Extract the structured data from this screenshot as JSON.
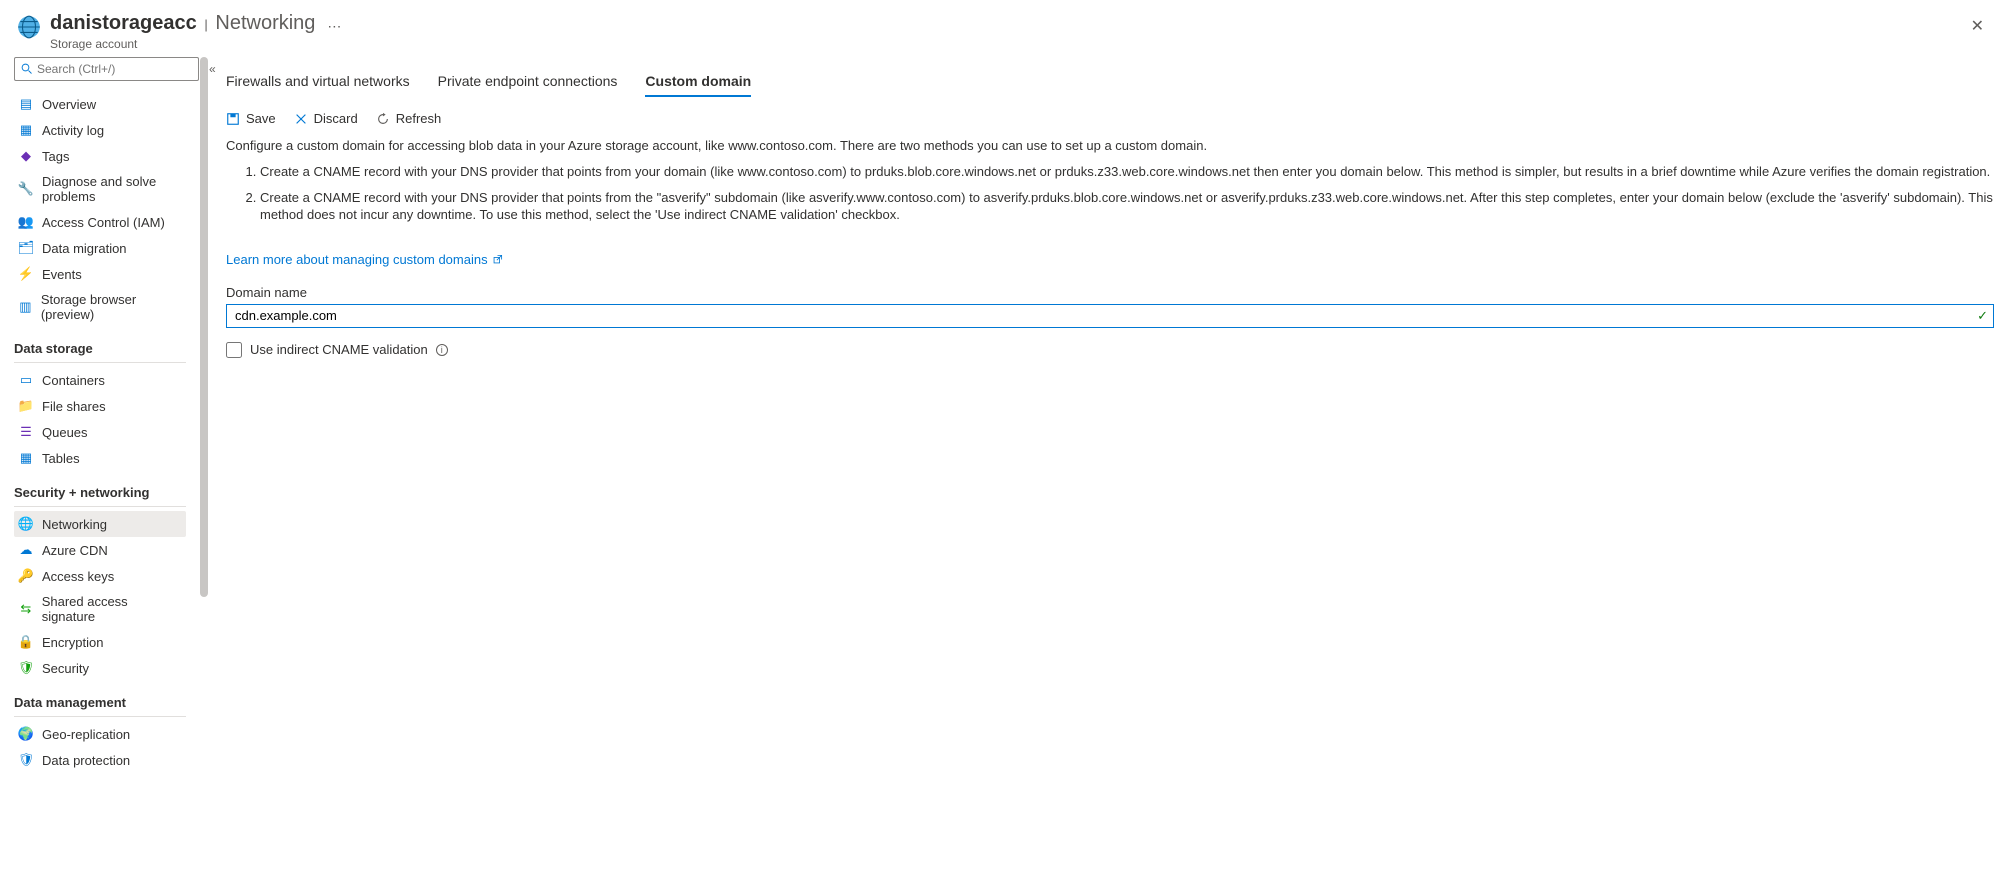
{
  "header": {
    "resource_name": "danistorageacc",
    "section": "Networking",
    "subtitle": "Storage account"
  },
  "search": {
    "placeholder": "Search (Ctrl+/)"
  },
  "nav": {
    "top": [
      {
        "label": "Overview"
      },
      {
        "label": "Activity log"
      },
      {
        "label": "Tags"
      },
      {
        "label": "Diagnose and solve problems"
      },
      {
        "label": "Access Control (IAM)"
      },
      {
        "label": "Data migration"
      },
      {
        "label": "Events"
      },
      {
        "label": "Storage browser (preview)"
      }
    ],
    "data_storage_label": "Data storage",
    "data_storage": [
      {
        "label": "Containers"
      },
      {
        "label": "File shares"
      },
      {
        "label": "Queues"
      },
      {
        "label": "Tables"
      }
    ],
    "security_label": "Security + networking",
    "security": [
      {
        "label": "Networking"
      },
      {
        "label": "Azure CDN"
      },
      {
        "label": "Access keys"
      },
      {
        "label": "Shared access signature"
      },
      {
        "label": "Encryption"
      },
      {
        "label": "Security"
      }
    ],
    "data_mgmt_label": "Data management",
    "data_mgmt": [
      {
        "label": "Geo-replication"
      },
      {
        "label": "Data protection"
      }
    ]
  },
  "tabs": [
    {
      "label": "Firewalls and virtual networks"
    },
    {
      "label": "Private endpoint connections"
    },
    {
      "label": "Custom domain"
    }
  ],
  "toolbar": {
    "save": "Save",
    "discard": "Discard",
    "refresh": "Refresh"
  },
  "description": "Configure a custom domain for accessing blob data in your Azure storage account, like www.contoso.com. There are two methods you can use to set up a custom domain.",
  "steps": [
    "Create a CNAME record with your DNS provider that points from your domain (like www.contoso.com) to prduks.blob.core.windows.net or prduks.z33.web.core.windows.net then enter you domain below. This method is simpler, but results in a brief downtime while Azure verifies the domain registration.",
    "Create a CNAME record with your DNS provider that points from the \"asverify\" subdomain (like asverify.www.contoso.com) to asverify.prduks.blob.core.windows.net or asverify.prduks.z33.web.core.windows.net. After this step completes, enter your domain below (exclude the 'asverify' subdomain). This method does not incur any downtime. To use this method, select the 'Use indirect CNAME validation' checkbox."
  ],
  "learn_more": "Learn more about managing custom domains",
  "form": {
    "domain_label": "Domain name",
    "domain_value": "cdn.example.com",
    "cname_label": "Use indirect CNAME validation"
  }
}
